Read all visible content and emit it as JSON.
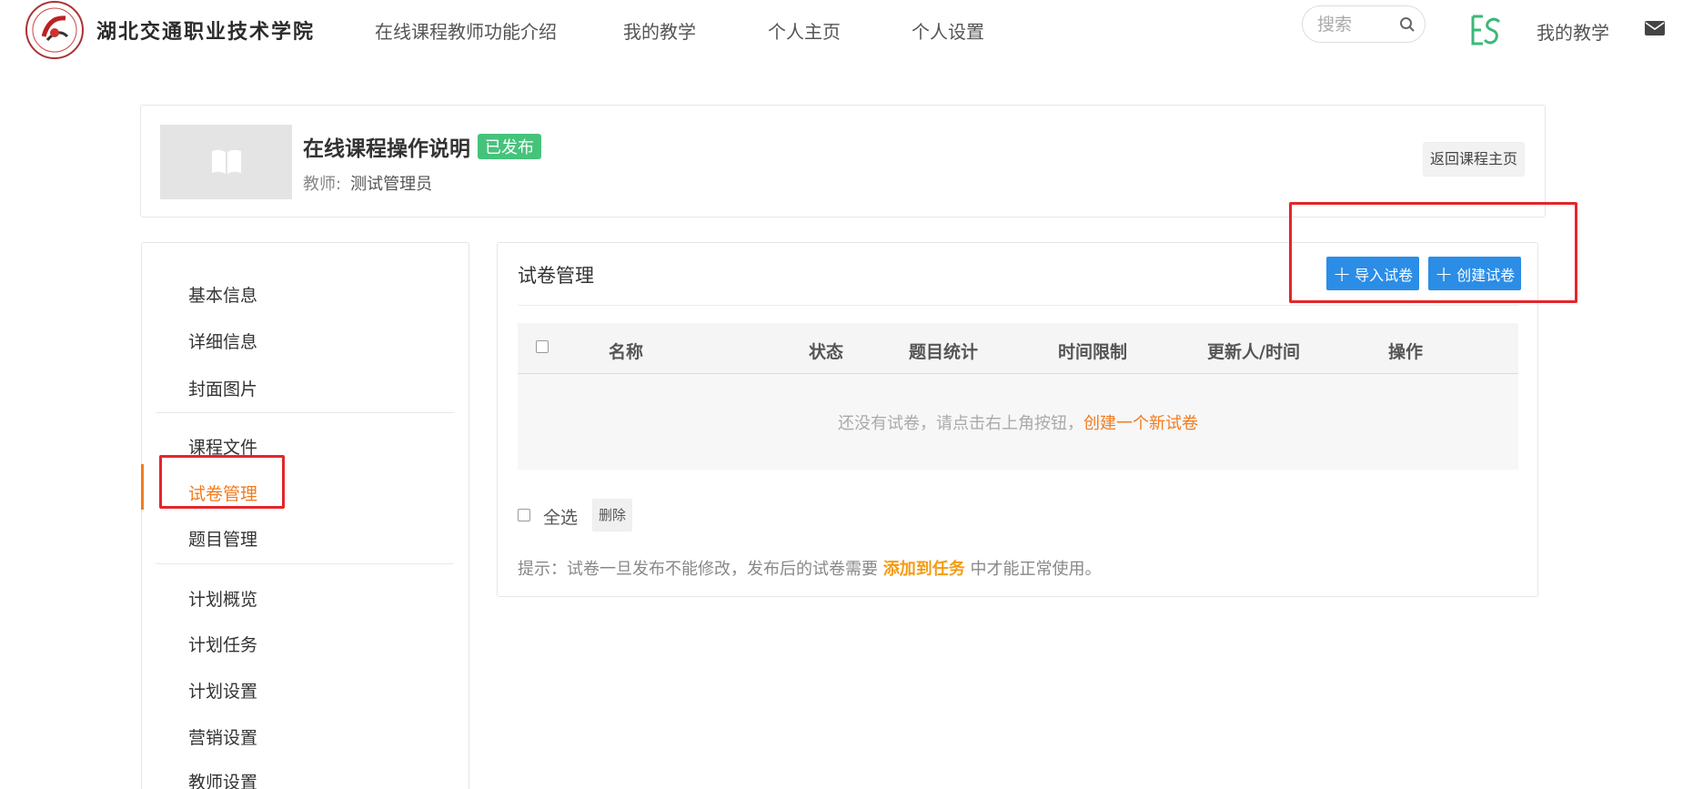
{
  "header": {
    "school_name": "湖北交通职业技术学院",
    "nav": [
      {
        "label": "在线课程教师功能介绍"
      },
      {
        "label": "我的教学"
      },
      {
        "label": "个人主页"
      },
      {
        "label": "个人设置"
      }
    ],
    "search_placeholder": "搜索",
    "my_teaching": "我的教学"
  },
  "course": {
    "title": "在线课程操作说明",
    "status": "已发布",
    "teacher_label": "教师:",
    "teacher_name": "测试管理员",
    "back_button": "返回课程主页"
  },
  "sidebar": {
    "items": [
      {
        "label": "基本信息"
      },
      {
        "label": "详细信息"
      },
      {
        "label": "封面图片"
      },
      {
        "label": "课程文件"
      },
      {
        "label": "试卷管理"
      },
      {
        "label": "题目管理"
      },
      {
        "label": "计划概览"
      },
      {
        "label": "计划任务"
      },
      {
        "label": "计划设置"
      },
      {
        "label": "营销设置"
      },
      {
        "label": "教师设置"
      }
    ],
    "active_index": 4
  },
  "panel": {
    "title": "试卷管理",
    "import_button": "导入试卷",
    "create_button": "创建试卷",
    "columns": [
      "名称",
      "状态",
      "题目统计",
      "时间限制",
      "更新人/时间",
      "操作"
    ],
    "empty_text": "还没有试卷，请点击右上角按钮，",
    "empty_link": "创建一个新试卷",
    "select_all": "全选",
    "delete_button": "删除",
    "tip_prefix": "提示：试卷一旦发布不能修改，发布后的试卷需要",
    "tip_link": "添加到任务",
    "tip_suffix": "中才能正常使用。"
  },
  "colors": {
    "accent_orange": "#f37b1d",
    "primary_blue": "#2b8de6",
    "published_green": "#46c37b",
    "annotation_red": "#e4262b"
  }
}
